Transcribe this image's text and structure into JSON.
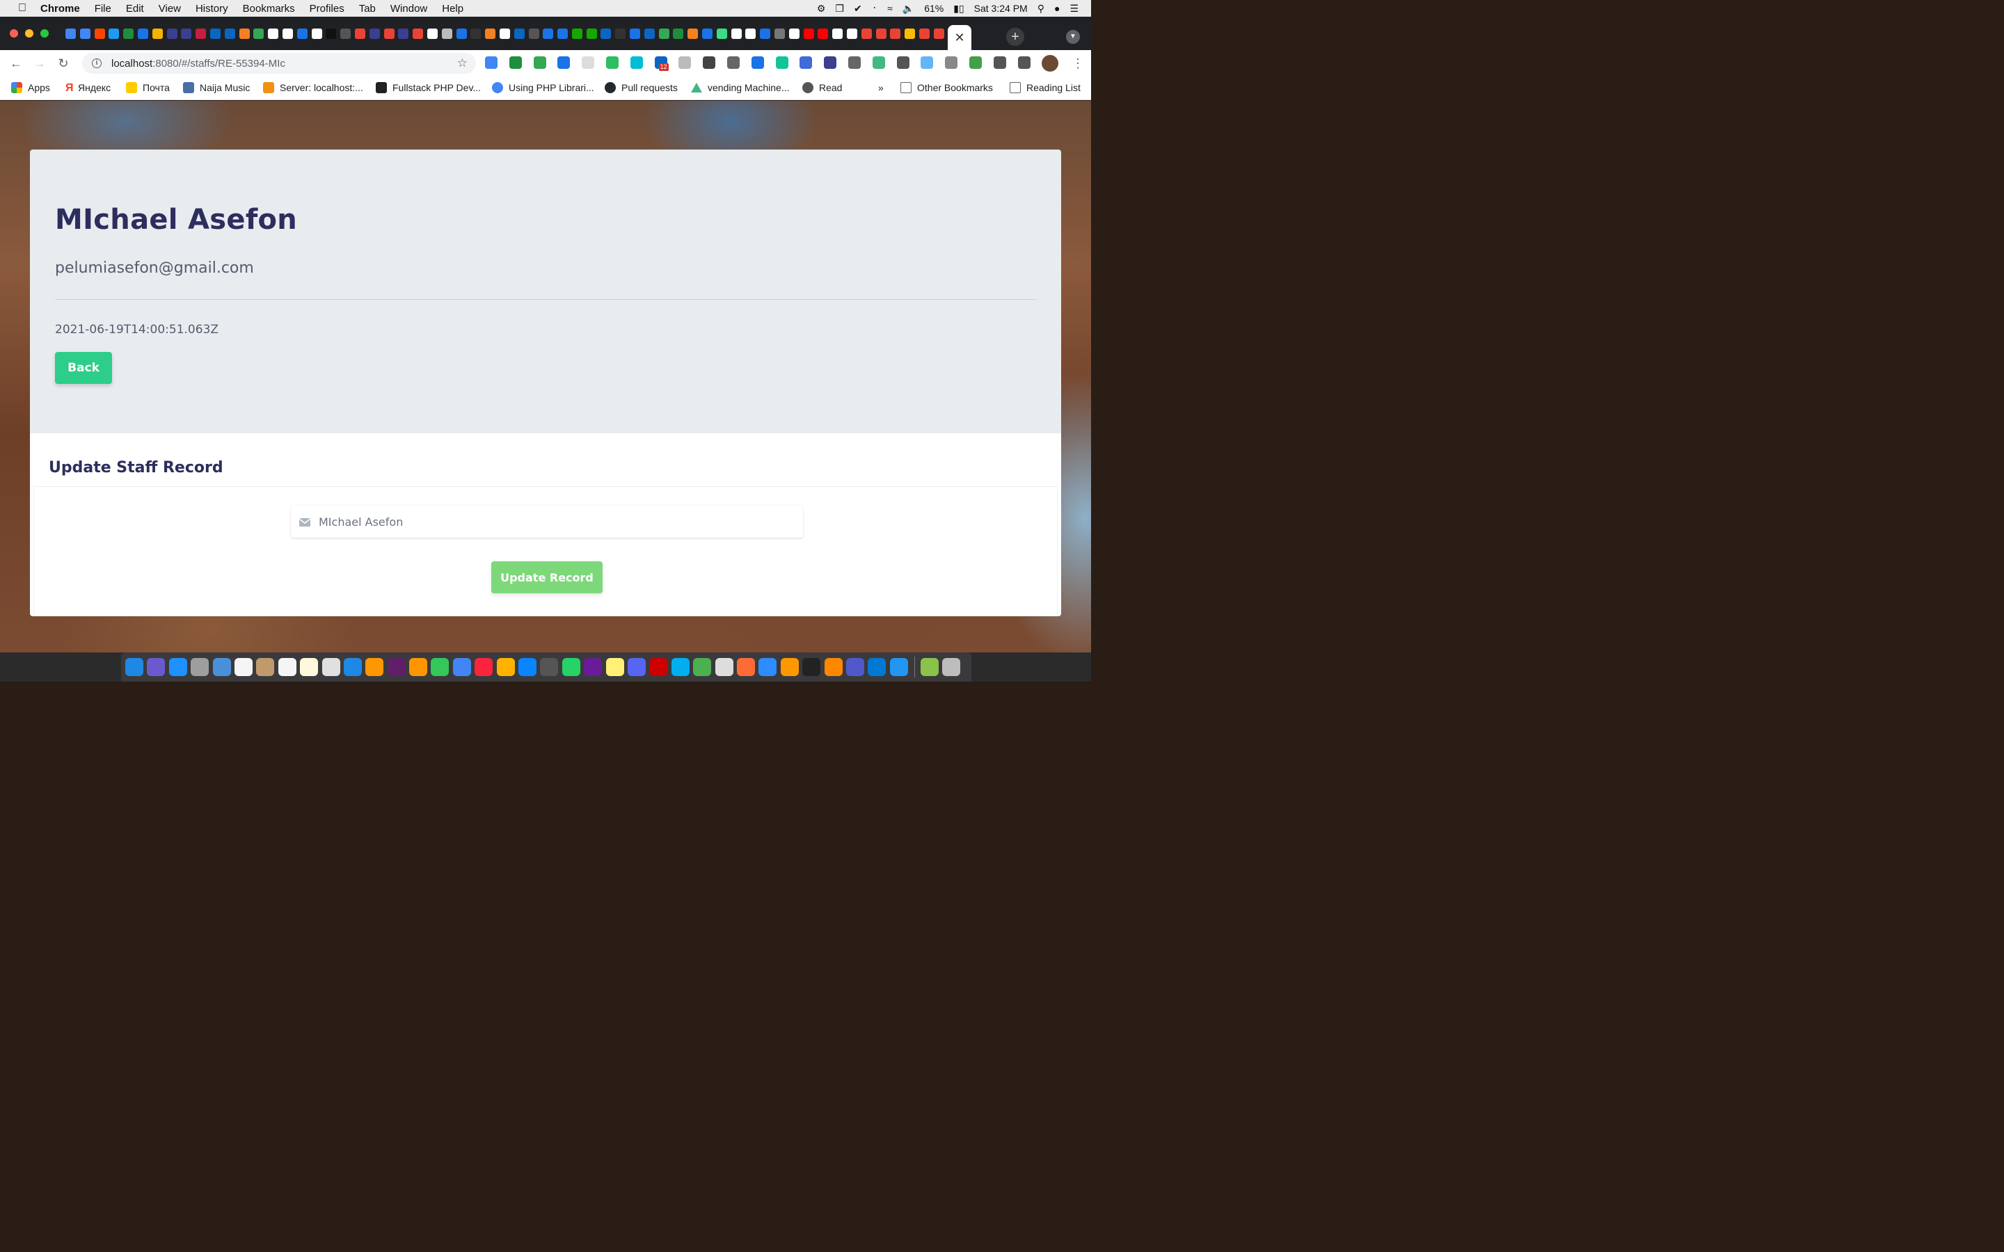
{
  "menubar": {
    "app_name": "Chrome",
    "items": [
      "File",
      "Edit",
      "View",
      "History",
      "Bookmarks",
      "Profiles",
      "Tab",
      "Window",
      "Help"
    ],
    "battery": "61%",
    "clock": "Sat 3:24 PM"
  },
  "tabs": {
    "active_close": "✕",
    "new_tab": "+",
    "favicon_colors": [
      "#4285f4",
      "#4285f4",
      "#ff4500",
      "#1d9bf0",
      "#1e8e3e",
      "#1a73e8",
      "#f4b400",
      "#3b3f8f",
      "#3b3f8f",
      "#c41f3e",
      "#0a66c2",
      "#0a66c2",
      "#f48024",
      "#34a853",
      "#ffffff",
      "#ffffff",
      "#1a73e8",
      "#ffffff",
      "#111111",
      "#555555",
      "#ea4335",
      "#3b3f8f",
      "#ea4335",
      "#3b3f8f",
      "#ea4335",
      "#ffffff",
      "#bbbbbb",
      "#1a73e8",
      "#333333",
      "#f48024",
      "#ffffff",
      "#0a66c2",
      "#555555",
      "#1a73e8",
      "#1a73e8",
      "#14a800",
      "#14a800",
      "#0a66c2",
      "#333333",
      "#1a73e8",
      "#0a66c2",
      "#34a853",
      "#1e8e3e",
      "#f48024",
      "#1a73e8",
      "#3ddc84",
      "#ffffff",
      "#ffffff",
      "#1a73e8",
      "#777777",
      "#ffffff",
      "#ff0000",
      "#ff0000",
      "#ffffff",
      "#ffffff",
      "#ea4335",
      "#ea4335",
      "#ea4335",
      "#fbbc05",
      "#ea4335",
      "#ea4335"
    ]
  },
  "toolbar": {
    "url_host": "localhost",
    "url_rest": ":8080/#/staffs/RE-55394-MIc",
    "extension_colors": [
      "#4285f4",
      "#1e8e3e",
      "#34a853",
      "#1a73e8",
      "#dddddd",
      "#2dbe60",
      "#00bcd4",
      "#0a66c2",
      "#bbbbbb",
      "#444444",
      "#666666",
      "#1a73e8",
      "#15c39a",
      "#3f6ad8",
      "#3b3f8f",
      "#666666",
      "#42b883",
      "#555555",
      "#64b5f6",
      "#888888",
      "#43a047",
      "#555555",
      "#555555"
    ],
    "linkedin_badge": "12"
  },
  "bookmarks": {
    "items": [
      {
        "label": "Apps",
        "color": "#ea4335"
      },
      {
        "label": "Яндекс",
        "color": "#fc3f1d"
      },
      {
        "label": "Почта",
        "color": "#ffcc00"
      },
      {
        "label": "Naija Music",
        "color": "#4a6fa5"
      },
      {
        "label": "Server: localhost:...",
        "color": "#f29111"
      },
      {
        "label": "Fullstack PHP Dev...",
        "color": "#222222"
      },
      {
        "label": "Using PHP Librari...",
        "color": "#4285f4"
      },
      {
        "label": "Pull requests",
        "color": "#24292e"
      },
      {
        "label": "vending Machine...",
        "color": "#41b883"
      },
      {
        "label": "Read",
        "color": "#555555"
      }
    ],
    "overflow": "»",
    "other": "Other Bookmarks",
    "reading_list": "Reading List"
  },
  "staff": {
    "name": "MIchael Asefon",
    "email": "pelumiasefon@gmail.com",
    "created_at": "2021-06-19T14:00:51.063Z",
    "back_label": "Back"
  },
  "form": {
    "title": "Update Staff Record",
    "name_value": "MIchael Asefon",
    "submit_label": "Update Record"
  },
  "dock": {
    "apps_colors": [
      "#1e88e5",
      "#6a5acd",
      "#1e90ff",
      "#9e9e9e",
      "#4a90d9",
      "#f5f5f5",
      "#c19a6b",
      "#f5f5f5",
      "#fff8dc",
      "#e0e0e0",
      "#1e88e5",
      "#ff9800",
      "#611f69",
      "#ff9500",
      "#34c759",
      "#4285f4",
      "#fa243c",
      "#ffb300",
      "#0a84ff",
      "#555555",
      "#25d366",
      "#6a1b9a",
      "#fff176",
      "#5865f2",
      "#cc0000",
      "#00aff0",
      "#4caf50",
      "#dddddd",
      "#ff6b35",
      "#2d8cff",
      "#ff9800",
      "#222222",
      "#ff8800",
      "#5059c9",
      "#0078d4",
      "#2196f3"
    ],
    "trailing_colors": [
      "#8bc34a",
      "#bdbdbd"
    ]
  }
}
